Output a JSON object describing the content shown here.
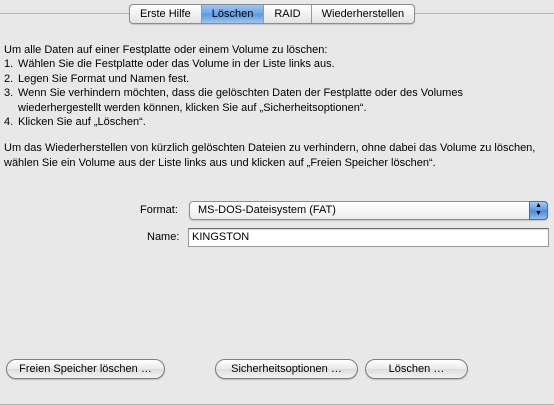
{
  "tabs": [
    {
      "label": "Erste Hilfe",
      "selected": false
    },
    {
      "label": "Löschen",
      "selected": true
    },
    {
      "label": "RAID",
      "selected": false
    },
    {
      "label": "Wiederherstellen",
      "selected": false
    }
  ],
  "instructions": {
    "intro": "Um alle Daten auf einer Festplatte oder einem Volume zu löschen:",
    "steps": [
      {
        "num": "1.",
        "text": "Wählen Sie die Festplatte oder das Volume in der Liste links aus."
      },
      {
        "num": "2.",
        "text": "Legen Sie Format und Namen fest."
      },
      {
        "num": "3.",
        "text": "Wenn Sie verhindern möchten, dass die gelöschten Daten der Festplatte oder des Volumes wiederhergestellt werden können, klicken Sie auf „Sicherheitsoptionen“."
      },
      {
        "num": "4.",
        "text": "Klicken Sie auf „Löschen“."
      }
    ],
    "paragraph2": "Um das Wiederherstellen von kürzlich gelöschten Dateien zu verhindern, ohne dabei das Volume zu löschen, wählen Sie ein Volume aus der Liste links aus und klicken auf „Freien Speicher löschen“."
  },
  "form": {
    "format_label": "Format:",
    "format_value": "MS-DOS-Dateisystem (FAT)",
    "name_label": "Name:",
    "name_value": "KINGSTON"
  },
  "buttons": {
    "free_space": "Freien Speicher löschen …",
    "security": "Sicherheitsoptionen …",
    "delete": "Löschen …"
  },
  "colors": {
    "selected_tab": "#6aa3e6",
    "background": "#e8e8e8"
  },
  "icons": {
    "select_arrows": "up-down-arrows-icon"
  }
}
